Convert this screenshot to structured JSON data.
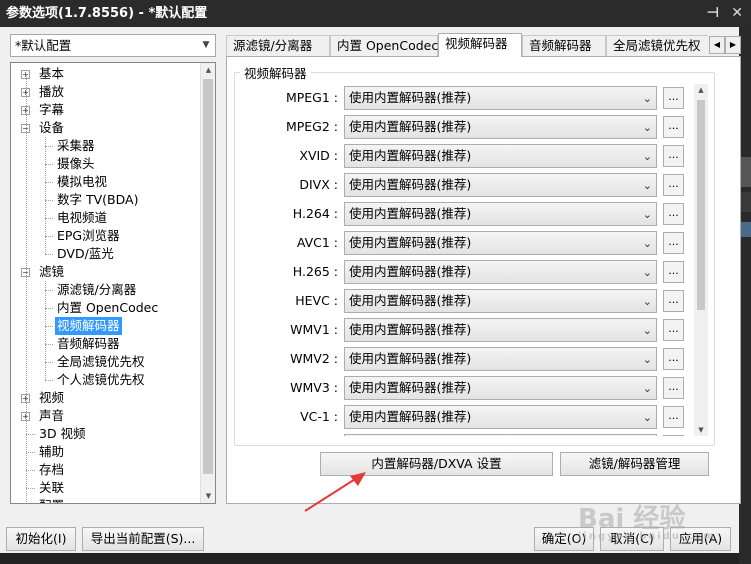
{
  "window": {
    "title": "参数选项(1.7.8556) - *默认配置",
    "pin_icon": "pin-icon",
    "close_icon": "close-icon"
  },
  "profile": {
    "selected": "*默认配置"
  },
  "tree": {
    "items": [
      {
        "label": "基本",
        "level": 0,
        "expander": "+"
      },
      {
        "label": "播放",
        "level": 0,
        "expander": "+"
      },
      {
        "label": "字幕",
        "level": 0,
        "expander": "+"
      },
      {
        "label": "设备",
        "level": 0,
        "expander": "-"
      },
      {
        "label": "采集器",
        "level": 1
      },
      {
        "label": "摄像头",
        "level": 1
      },
      {
        "label": "模拟电视",
        "level": 1
      },
      {
        "label": "数字 TV(BDA)",
        "level": 1
      },
      {
        "label": "电视频道",
        "level": 1
      },
      {
        "label": "EPG浏览器",
        "level": 1
      },
      {
        "label": "DVD/蓝光",
        "level": 1
      },
      {
        "label": "滤镜",
        "level": 0,
        "expander": "-"
      },
      {
        "label": "源滤镜/分离器",
        "level": 1
      },
      {
        "label": "内置 OpenCodec",
        "level": 1
      },
      {
        "label": "视频解码器",
        "level": 1,
        "selected": true
      },
      {
        "label": "音频解码器",
        "level": 1
      },
      {
        "label": "全局滤镜优先权",
        "level": 1
      },
      {
        "label": "个人滤镜优先权",
        "level": 1
      },
      {
        "label": "视频",
        "level": 0,
        "expander": "+"
      },
      {
        "label": "声音",
        "level": 0,
        "expander": "+"
      },
      {
        "label": "3D 视频",
        "level": 0
      },
      {
        "label": "辅助",
        "level": 0
      },
      {
        "label": "存档",
        "level": 0
      },
      {
        "label": "关联",
        "level": 0
      },
      {
        "label": "配置",
        "level": 0
      }
    ]
  },
  "tabs": [
    {
      "label": "源滤镜/分离器"
    },
    {
      "label": "内置 OpenCodec"
    },
    {
      "label": "视频解码器",
      "active": true
    },
    {
      "label": "音频解码器"
    },
    {
      "label": "全局滤镜优先权"
    }
  ],
  "panel": {
    "group_title": "视频解码器",
    "codecs": [
      {
        "name": "MPEG1 :",
        "value": "使用内置解码器(推荐)"
      },
      {
        "name": "MPEG2 :",
        "value": "使用内置解码器(推荐)"
      },
      {
        "name": "XVID :",
        "value": "使用内置解码器(推荐)"
      },
      {
        "name": "DIVX :",
        "value": "使用内置解码器(推荐)"
      },
      {
        "name": "H.264 :",
        "value": "使用内置解码器(推荐)"
      },
      {
        "name": "AVC1 :",
        "value": "使用内置解码器(推荐)"
      },
      {
        "name": "H.265 :",
        "value": "使用内置解码器(推荐)"
      },
      {
        "name": "HEVC :",
        "value": "使用内置解码器(推荐)"
      },
      {
        "name": "WMV1 :",
        "value": "使用内置解码器(推荐)"
      },
      {
        "name": "WMV2 :",
        "value": "使用内置解码器(推荐)"
      },
      {
        "name": "WMV3 :",
        "value": "使用内置解码器(推荐)"
      },
      {
        "name": "VC-1 :",
        "value": "使用内置解码器(推荐)"
      },
      {
        "name": "",
        "value": ""
      }
    ],
    "dots_label": "...",
    "dxva_button": "内置解码器/DXVA 设置",
    "manage_button": "滤镜/解码器管理"
  },
  "footer": {
    "init_button": "初始化(I)",
    "export_button": "导出当前配置(S)...",
    "ok_button": "确定(O)",
    "cancel_button": "取消(C)",
    "apply_button": "应用(A)"
  },
  "watermark": {
    "text": "Bai 经验",
    "sub": "jingyan.baidu.com"
  },
  "colors": {
    "titlebar": "#2b2b2b",
    "selection": "#3399ff",
    "annotation_arrow": "#e53935"
  }
}
